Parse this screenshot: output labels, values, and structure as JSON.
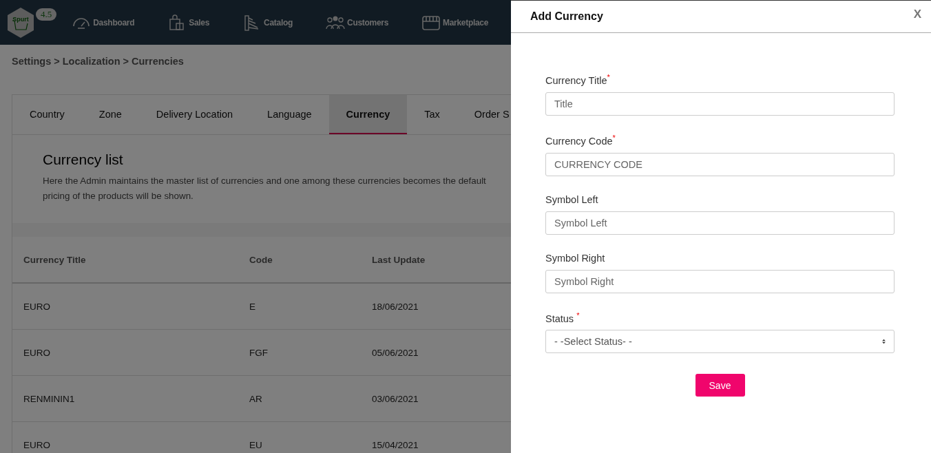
{
  "header": {
    "logo_text": "Spurt",
    "version": "4.5",
    "nav": [
      {
        "label": "Dashboard"
      },
      {
        "label": "Sales"
      },
      {
        "label": "Catalog"
      },
      {
        "label": "Customers"
      },
      {
        "label": "Marketplace"
      }
    ]
  },
  "breadcrumb": "Settings > Localization > Currencies",
  "tabs": [
    {
      "label": "Country",
      "selected": false
    },
    {
      "label": "Zone",
      "selected": false
    },
    {
      "label": "Delivery Location",
      "selected": false
    },
    {
      "label": "Language",
      "selected": false
    },
    {
      "label": "Currency",
      "selected": true
    },
    {
      "label": "Tax",
      "selected": false
    },
    {
      "label": "Order S",
      "selected": false
    }
  ],
  "section": {
    "title": "Currency list",
    "description": [
      "Here the Admin maintains the master list of currencies and one among these currencies becomes the default",
      "pricing of the products will be shown."
    ]
  },
  "table": {
    "columns": [
      "Currency Title",
      "Code",
      "Last Update"
    ],
    "rows": [
      [
        "EURO",
        "E",
        "18/06/2021"
      ],
      [
        "EURO",
        "FGF",
        "05/06/2021"
      ],
      [
        "RENMININ1",
        "AR",
        "03/06/2021"
      ],
      [
        "EURO",
        "EU",
        "15/04/2021"
      ]
    ]
  },
  "drawer": {
    "title": "Add Currency",
    "close": "X",
    "fields": [
      {
        "kind": "text",
        "label": "Currency Title$^{*}$",
        "placeholder": "Title"
      },
      {
        "kind": "text",
        "label": "Currency Code$^{*}$",
        "placeholder": "CURRENCY CODE"
      },
      {
        "kind": "text",
        "label": "Symbol Left",
        "placeholder": "Symbol Left"
      },
      {
        "kind": "text",
        "label": "Symbol Right",
        "placeholder": "Symbol Right"
      },
      {
        "kind": "select",
        "label": "Status $^{*}$",
        "value": "- -Select Status- -"
      }
    ],
    "save": "Save"
  }
}
